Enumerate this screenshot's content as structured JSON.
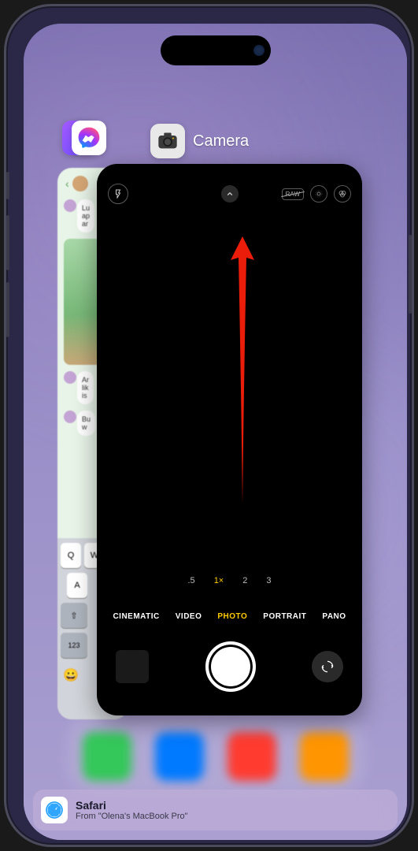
{
  "app_switcher": {
    "camera_card": {
      "app_name": "Camera",
      "zoom_levels": [
        ".5",
        "1×",
        "2",
        "3"
      ],
      "active_zoom_index": 1,
      "modes": [
        "CINEMATIC",
        "VIDEO",
        "PHOTO",
        "PORTRAIT",
        "PANO"
      ],
      "active_mode_index": 2,
      "raw_label": "RAW"
    },
    "messenger_card": {
      "msg1": "Lu",
      "msg2": "ap",
      "msg3": "ar",
      "msg4": "Ar",
      "msg5": "lik",
      "msg6": "is",
      "msg7": "Bu",
      "msg8": "w",
      "keys_row1": [
        "Q",
        "W"
      ],
      "keys_row2": [
        "A"
      ],
      "key_shift": "⇧",
      "key_123": "123",
      "key_emoji": "😀"
    }
  },
  "handoff": {
    "app": "Safari",
    "source": "From \"Olena's MacBook Pro\""
  },
  "annotation": {
    "arrow_color": "#ea1c0a"
  }
}
